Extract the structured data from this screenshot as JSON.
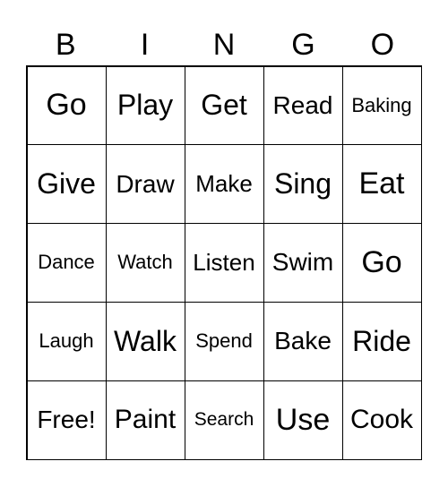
{
  "header": [
    "B",
    "I",
    "N",
    "G",
    "O"
  ],
  "cells": [
    "Go",
    "Play",
    "Get",
    "Read",
    "Baking",
    "Give",
    "Draw",
    "Make",
    "Sing",
    "Eat",
    "Dance",
    "Watch",
    "Listen",
    "Swim",
    "Go",
    "Laugh",
    "Walk",
    "Spend",
    "Bake",
    "Ride",
    "Free!",
    "Paint",
    "Search",
    "Use",
    "Cook"
  ]
}
